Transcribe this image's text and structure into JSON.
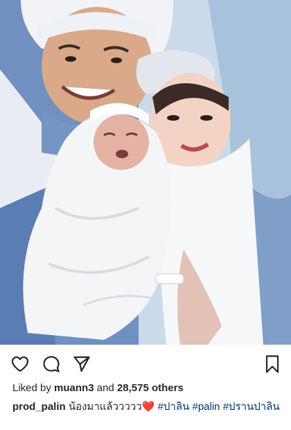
{
  "post": {
    "photo_description_icon": "photo",
    "actions": {
      "like_icon": "heart-outline-icon",
      "comment_icon": "comment-bubble-icon",
      "share_icon": "paper-plane-icon",
      "save_icon": "bookmark-icon"
    },
    "likes": {
      "prefix": "Liked by",
      "user": "muann3",
      "joiner": "and",
      "count": "28,575 others"
    },
    "caption": {
      "username": "prod_palin",
      "text": "น้องมาแล้ววววว",
      "emoji": "❤️",
      "hashtags": [
        "#ปาลิน",
        "#palin",
        "#ปรานปาลิน"
      ]
    }
  },
  "colors": {
    "hashtag": "#003569",
    "text": "#262626",
    "heart_emoji": "#e0202e"
  }
}
